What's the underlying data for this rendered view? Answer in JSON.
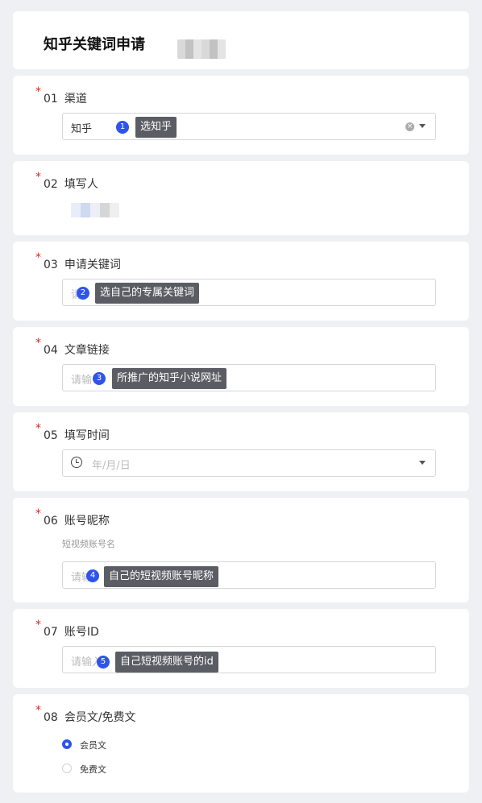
{
  "form": {
    "title": "知乎关键词申请"
  },
  "required_mark": "*",
  "questions": [
    {
      "num": "01",
      "label": "渠道",
      "value": "知乎"
    },
    {
      "num": "02",
      "label": "填写人"
    },
    {
      "num": "03",
      "label": "申请关键词",
      "placeholder": "请"
    },
    {
      "num": "04",
      "label": "文章链接",
      "placeholder": "请输"
    },
    {
      "num": "05",
      "label": "填写时间",
      "placeholder": "年/月/日"
    },
    {
      "num": "06",
      "label": "账号昵称",
      "hint": "短视频账号名",
      "placeholder": "请输"
    },
    {
      "num": "07",
      "label": "账号ID",
      "placeholder": "请输入"
    },
    {
      "num": "08",
      "label": "会员文/免费文",
      "options": [
        {
          "label": "会员文",
          "selected": true
        },
        {
          "label": "免费文",
          "selected": false
        }
      ]
    }
  ],
  "annotations": [
    {
      "step": "1",
      "text": "选知乎"
    },
    {
      "step": "2",
      "text": "选自己的专属关键词"
    },
    {
      "step": "3",
      "text": "所推广的知乎小说网址"
    },
    {
      "step": "4",
      "text": "自己的短视频账号昵称"
    },
    {
      "step": "5",
      "text": "自己短视频账号的id"
    }
  ],
  "colors": {
    "accent": "#2f54eb",
    "required": "#e0271f",
    "tooltip": "#5a5d63"
  }
}
